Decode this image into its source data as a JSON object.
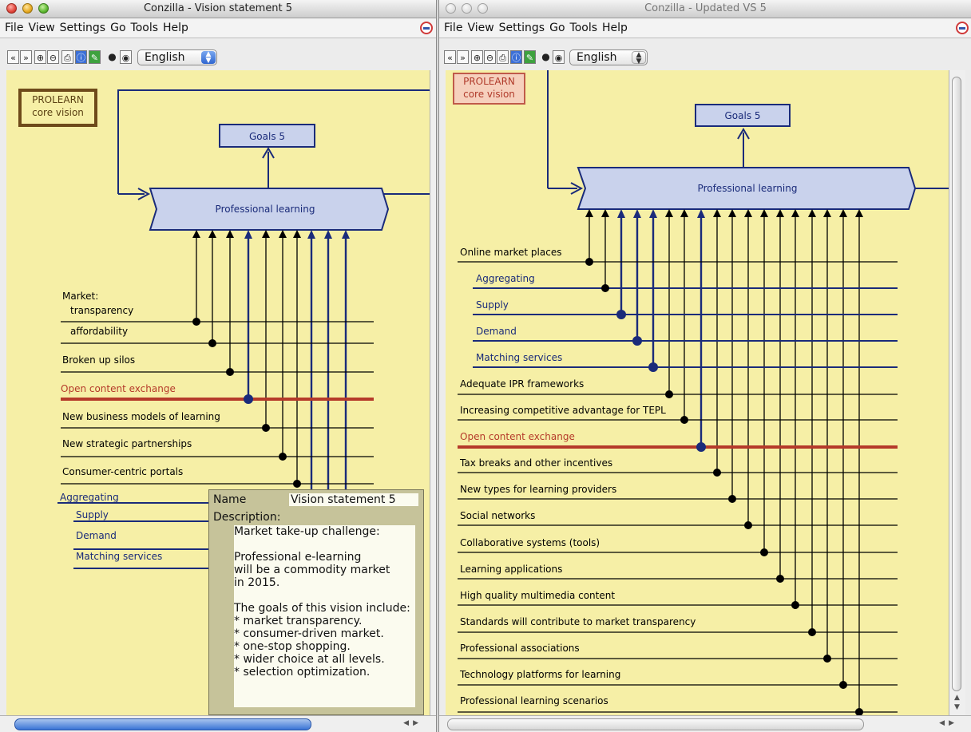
{
  "left_window": {
    "title": "Conzilla - Vision statement 5",
    "menu": [
      "File",
      "View",
      "Settings",
      "Go",
      "Tools",
      "Help"
    ],
    "language": "English",
    "map": {
      "corner_box": "PROLEARN\ncore vision",
      "goals": "Goals 5",
      "central": "Professional learning",
      "labels": {
        "market": "Market:",
        "transparency": "transparency",
        "affordability": "affordability",
        "silos": "Broken up silos",
        "open_content": "Open content exchange",
        "business_models": "New business models of learning",
        "partnerships": "New strategic partnerships",
        "portals": "Consumer-centric portals",
        "aggregating": "Aggregating",
        "supply": "Supply",
        "demand": "Demand",
        "matching": "Matching services"
      }
    },
    "popup": {
      "name_label": "Name",
      "name_value": "Vision statement 5",
      "description_label": "Description:",
      "description": "Market take-up challenge:\n\nProfessional e-learning\nwill be a commodity market\nin 2015.\n\nThe goals of this vision include:\n* market transparency.\n* consumer-driven market.\n* one-stop shopping.\n* wider choice at all levels.\n* selection optimization."
    }
  },
  "right_window": {
    "title": "Conzilla - Updated VS 5",
    "menu": [
      "File",
      "View",
      "Settings",
      "Go",
      "Tools",
      "Help"
    ],
    "language": "English",
    "map": {
      "corner_box": "PROLEARN\ncore vision",
      "goals": "Goals 5",
      "central": "Professional learning",
      "items": [
        "Online market places",
        "Aggregating",
        "Supply",
        "Demand",
        "Matching services",
        "Adequate IPR frameworks",
        "Increasing competitive advantage for TEPL",
        "Open content exchange",
        "Tax breaks and other incentives",
        "New types for learning providers",
        "Social networks",
        "Collaborative systems (tools)",
        "Learning applications",
        "High quality multimedia content",
        "Standards will contribute to market transparency",
        "Professional associations",
        "Technology platforms for learning",
        "Professional learning scenarios"
      ]
    }
  },
  "colors": {
    "canvas": "#f6efa6",
    "navy": "#1a2b7a",
    "highlight": "#b53a2a",
    "concept_fill": "#c9d2ec",
    "corner_box_border": "#6e4a1a"
  }
}
